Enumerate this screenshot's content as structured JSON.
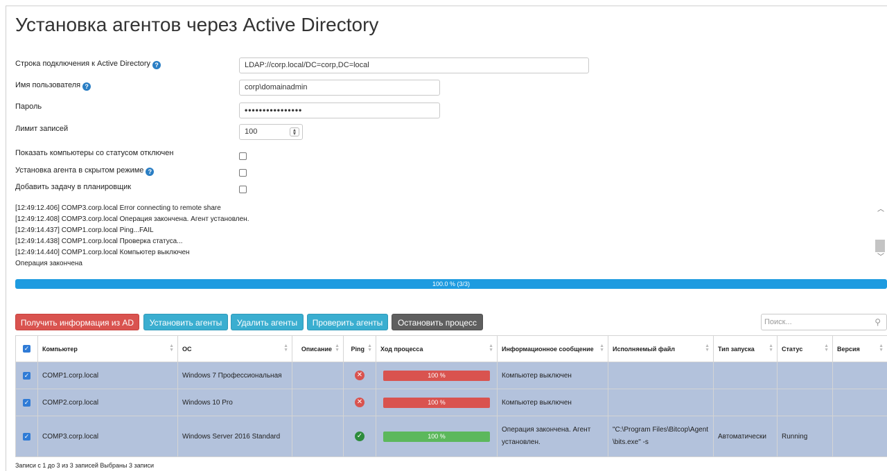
{
  "page": {
    "title": "Установка агентов через Active Directory"
  },
  "form": {
    "connection_label": "Строка подключения к Active Directory",
    "connection_value": "LDAP://corp.local/DC=corp,DC=local",
    "username_label": "Имя пользователя",
    "username_value": "corp\\domainadmin",
    "password_label": "Пароль",
    "password_dots": "••••••••••••••••",
    "limit_label": "Лимит записей",
    "limit_value": "100",
    "show_disabled_label": "Показать компьютеры со статусом отключен",
    "hidden_mode_label": "Установка агента в скрытом режиме",
    "scheduler_label": "Добавить задачу в планировщик",
    "help_glyph": "?"
  },
  "log": {
    "lines": [
      "[12:49:12.406] COMP3.corp.local Error connecting to remote share",
      "[12:49:12.408] COMP3.corp.local Операция закончена. Агент установлен.",
      "[12:49:14.437] COMP1.corp.local Ping...FAIL",
      "[12:49:14.438] COMP1.corp.local Проверка статуса...",
      "[12:49:14.440] COMP1.corp.local Компьютер выключен",
      "Операция закончена"
    ]
  },
  "progress": {
    "value": 1.0,
    "label": "100.0 % (3/3)"
  },
  "toolbar": {
    "get_info": "Получить информация из AD",
    "install": "Установить агенты",
    "remove": "Удалить агенты",
    "check": "Проверить агенты",
    "stop": "Остановить процесс",
    "search_placeholder": "Поиск..."
  },
  "table": {
    "headers": {
      "computer": "Компьютер",
      "os": "ОС",
      "description": "Описание",
      "ping": "Ping",
      "progress": "Ход процесса",
      "message": "Информационное сообщение",
      "executable": "Исполняемый файл",
      "launch_type": "Тип запуска",
      "status": "Статус",
      "version": "Версия"
    },
    "rows": [
      {
        "computer": "COMP1.corp.local",
        "os": "Windows 7 Профессиональная",
        "description": "",
        "ping": "fail",
        "progress": "100 %",
        "message": "Компьютер выключен",
        "executable": "",
        "launch_type": "",
        "status": "",
        "version": ""
      },
      {
        "computer": "COMP2.corp.local",
        "os": "Windows 10 Pro",
        "description": "",
        "ping": "fail",
        "progress": "100 %",
        "message": "Компьютер выключен",
        "executable": "",
        "launch_type": "",
        "status": "",
        "version": ""
      },
      {
        "computer": "COMP3.corp.local",
        "os": "Windows Server 2016 Standard",
        "description": "",
        "ping": "ok",
        "progress": "100 %",
        "message": "Операция закончена. Агент установлен.",
        "executable": "\"C:\\Program Files\\Bitcop\\Agent\\bits.exe\" -s",
        "launch_type": "Автоматически",
        "status": "Running",
        "version": ""
      }
    ]
  },
  "footer": {
    "text": "Записи с 1 до 3 из 3 записей   Выбраны 3 записи"
  },
  "colors": {
    "primary_blue": "#1e9be0",
    "row_selected": "#b3c2dc",
    "danger": "#d9534f",
    "success": "#5cb85c"
  }
}
